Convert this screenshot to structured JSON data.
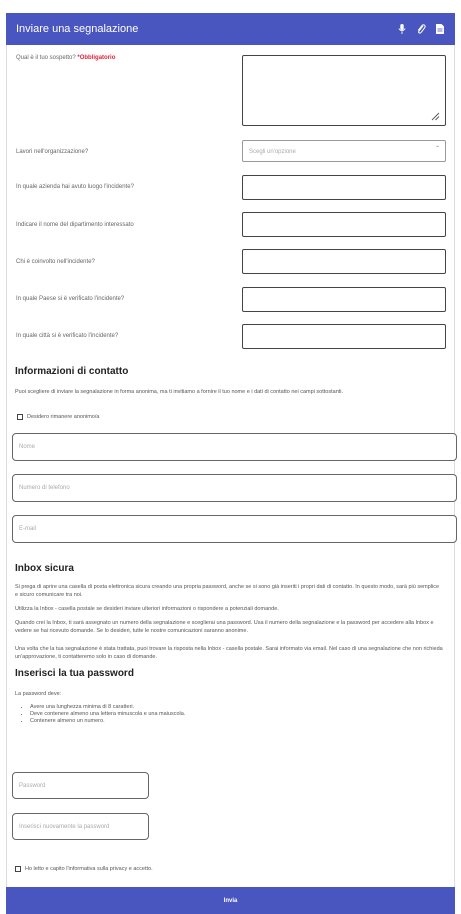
{
  "header": {
    "title": "Inviare una segnalazione",
    "icons": [
      "microphone-icon",
      "paperclip-icon",
      "document-icon"
    ]
  },
  "form": {
    "suspect_label": "Qual è il tuo sospetto?",
    "required_text": "*Obbligatorio",
    "work_label": "Lavori nell'organizzazione?",
    "work_placeholder": "Scegli un'opzione",
    "company_label": "In quale azienda hai avuto luogo l'incidente?",
    "department_label": "Indicare il nome del dipartimento interessato",
    "involved_label": "Chi è coinvolto nell'incidente?",
    "country_label": "In quale Paese si è verificato l'incidente?",
    "city_label": "In quale città si è verificato l'incidente?"
  },
  "contact": {
    "heading": "Informazioni di contatto",
    "intro": "Puoi scegliere di inviare la segnalazione in forma anonima, ma ti invitiamo a fornire il tuo nome e i dati di contatto nei campi sottostanti.",
    "anonymous_label": "Desidero rimanere anonimo/a",
    "name_placeholder": "Nome",
    "phone_placeholder": "Numero di telefono",
    "email_placeholder": "E-mail"
  },
  "inbox": {
    "heading": "Inbox sicura",
    "p1": "Si prega di aprire una casella di posta elettronica sicura creando una propria password, anche se si sono già inseriti i propri dati di contatto. In questo modo, sarà più semplice e sicuro comunicare tra noi.",
    "p2": "Utilizza la Inbox - casella postale se desideri inviare ulteriori informazioni o rispondere a potenziali domande.",
    "p3": "Quando crei la Inbox, ti sarà assegnato un numero della segnalazione e sceglierai una password. Usa il numero della segnalazione e la password per accedere alla Inbox e vedere se hai ricevuto domande. Se lo desideri, tutte le nostre comunicazioni saranno anonime.",
    "p4": "Una volta che la tua segnalazione è stata trattata, puoi trovare la risposta nella Inbox - casella postale. Sarai informato via email. Nel caso di una segnalazione che non richieda un'approvazione, ti contatteremo solo in caso di domande."
  },
  "password": {
    "heading": "Inserisci la tua password",
    "intro": "La password deve:",
    "rules": [
      "Avere una lunghezza minima di 8 caratteri.",
      "Deve contenere almeno una lettera minuscola e una maiuscola.",
      "Contenere almeno un numero."
    ],
    "password_placeholder": "Password",
    "repeat_placeholder": "Inserisci nuovamente la password"
  },
  "privacy": {
    "label": "Ho letto e capito l'informativa sulla privacy e accetto."
  },
  "submit_label": "Invia",
  "colors": {
    "accent": "#4a56bf",
    "required": "#e0223a"
  }
}
